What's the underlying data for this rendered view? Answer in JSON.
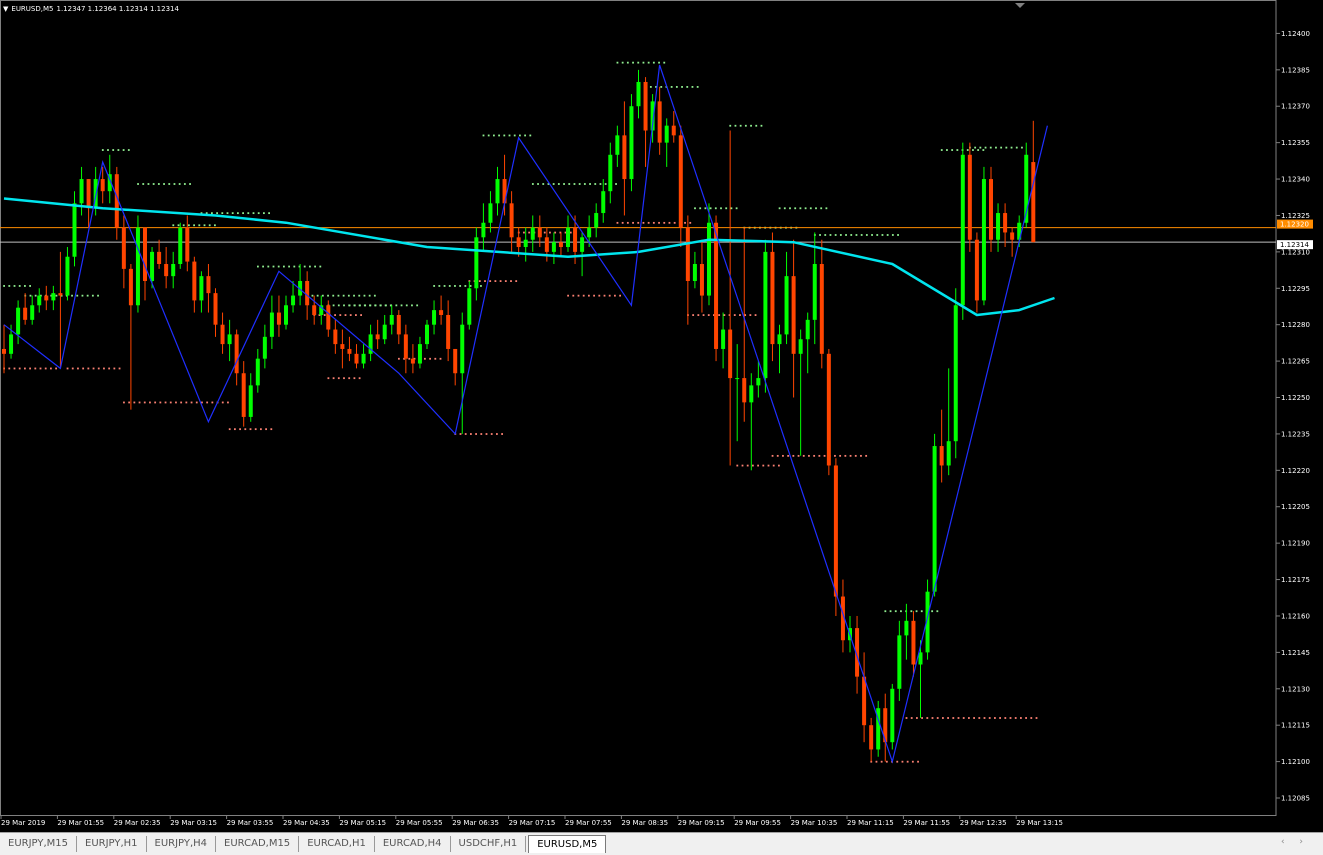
{
  "header": {
    "symbol": "EURUSD,M5",
    "ohlc": "1.12347 1.12364 1.12314 1.12314"
  },
  "tabs": [
    {
      "label": "EURJPY,M15",
      "active": false
    },
    {
      "label": "EURJPY,H1",
      "active": false
    },
    {
      "label": "EURJPY,H4",
      "active": false
    },
    {
      "label": "EURCAD,M15",
      "active": false
    },
    {
      "label": "EURCAD,H1",
      "active": false
    },
    {
      "label": "EURCAD,H4",
      "active": false
    },
    {
      "label": "USDCHF,H1",
      "active": false
    },
    {
      "label": "EURUSD,M5",
      "active": true
    }
  ],
  "scroll_arrows": "‹ ›",
  "chart_data": {
    "type": "candlestick",
    "symbol": "EURUSD",
    "timeframe": "M5",
    "colors": {
      "background": "#000000",
      "bull": "#00ff00",
      "bear": "#ff4500",
      "moving_average": "#00e5ee",
      "zigzag": "#1f2fff",
      "resistance_dots": "#90ee90",
      "support_dots": "#fa8072",
      "bid_line": "#c0c0c0",
      "ask_line": "#ff8c00",
      "axis_text": "#ffffff"
    },
    "y_axis": {
      "min": 1.12078,
      "max": 1.12408,
      "ticks": [
        "1.12400",
        "1.12385",
        "1.12370",
        "1.12355",
        "1.12340",
        "1.12325",
        "1.12310",
        "1.12295",
        "1.12280",
        "1.12265",
        "1.12250",
        "1.12235",
        "1.12220",
        "1.12205",
        "1.12190",
        "1.12175",
        "1.12160",
        "1.12145",
        "1.12130",
        "1.12115",
        "1.12100",
        "1.12085"
      ]
    },
    "x_axis": {
      "labels": [
        "29 Mar 2019",
        "29 Mar 01:55",
        "29 Mar 02:35",
        "29 Mar 03:15",
        "29 Mar 03:55",
        "29 Mar 04:35",
        "29 Mar 05:15",
        "29 Mar 05:55",
        "29 Mar 06:35",
        "29 Mar 07:15",
        "29 Mar 07:55",
        "29 Mar 08:35",
        "29 Mar 09:15",
        "29 Mar 09:55",
        "29 Mar 10:35",
        "29 Mar 11:15",
        "29 Mar 11:55",
        "29 Mar 12:35",
        "29 Mar 13:15"
      ],
      "candles_per_label": 8
    },
    "price_labels": [
      {
        "value": "1.12320",
        "kind": "ask"
      },
      {
        "value": "1.12314",
        "kind": "bid"
      }
    ],
    "ask_price": 1.1232,
    "bid_price": 1.12314,
    "ohlc": [
      [
        1.1227,
        1.1228,
        1.1226,
        1.12268
      ],
      [
        1.12268,
        1.1228,
        1.12266,
        1.12276
      ],
      [
        1.12276,
        1.1229,
        1.12272,
        1.12287
      ],
      [
        1.12287,
        1.12293,
        1.1228,
        1.12282
      ],
      [
        1.12282,
        1.12292,
        1.1228,
        1.12288
      ],
      [
        1.12288,
        1.12295,
        1.12285,
        1.12292
      ],
      [
        1.12292,
        1.12296,
        1.12286,
        1.1229
      ],
      [
        1.1229,
        1.12296,
        1.12286,
        1.12293
      ],
      [
        1.12293,
        1.1231,
        1.12262,
        1.12292
      ],
      [
        1.12292,
        1.12312,
        1.1229,
        1.12308
      ],
      [
        1.12308,
        1.12335,
        1.12304,
        1.1233
      ],
      [
        1.1233,
        1.12345,
        1.12325,
        1.1234
      ],
      [
        1.1234,
        1.1234,
        1.1232,
        1.12328
      ],
      [
        1.12328,
        1.12345,
        1.12325,
        1.1234
      ],
      [
        1.1234,
        1.12345,
        1.1233,
        1.12335
      ],
      [
        1.12335,
        1.1235,
        1.1233,
        1.12342
      ],
      [
        1.12342,
        1.12345,
        1.12315,
        1.1232
      ],
      [
        1.1232,
        1.12325,
        1.12295,
        1.12303
      ],
      [
        1.12303,
        1.12305,
        1.12245,
        1.12288
      ],
      [
        1.12288,
        1.12325,
        1.12285,
        1.1232
      ],
      [
        1.1232,
        1.1232,
        1.1229,
        1.12298
      ],
      [
        1.12298,
        1.12312,
        1.12295,
        1.1231
      ],
      [
        1.1231,
        1.12315,
        1.12303,
        1.12305
      ],
      [
        1.12305,
        1.12312,
        1.12295,
        1.123
      ],
      [
        1.123,
        1.1231,
        1.12295,
        1.12305
      ],
      [
        1.12305,
        1.12322,
        1.12303,
        1.1232
      ],
      [
        1.1232,
        1.12325,
        1.12302,
        1.12306
      ],
      [
        1.12306,
        1.12308,
        1.12285,
        1.1229
      ],
      [
        1.1229,
        1.12302,
        1.12285,
        1.123
      ],
      [
        1.123,
        1.12305,
        1.12285,
        1.12293
      ],
      [
        1.12293,
        1.12295,
        1.12275,
        1.1228
      ],
      [
        1.1228,
        1.12285,
        1.12268,
        1.12272
      ],
      [
        1.12272,
        1.12282,
        1.12265,
        1.12276
      ],
      [
        1.12276,
        1.12278,
        1.12255,
        1.1226
      ],
      [
        1.1226,
        1.12265,
        1.12238,
        1.12242
      ],
      [
        1.12242,
        1.1226,
        1.1224,
        1.12255
      ],
      [
        1.12255,
        1.1227,
        1.12252,
        1.12266
      ],
      [
        1.12266,
        1.1228,
        1.12262,
        1.12275
      ],
      [
        1.12275,
        1.12292,
        1.1227,
        1.12285
      ],
      [
        1.12285,
        1.12292,
        1.12275,
        1.1228
      ],
      [
        1.1228,
        1.12292,
        1.12278,
        1.12288
      ],
      [
        1.12288,
        1.12298,
        1.12285,
        1.12292
      ],
      [
        1.12292,
        1.12305,
        1.12288,
        1.12298
      ],
      [
        1.12298,
        1.12302,
        1.12282,
        1.12288
      ],
      [
        1.12288,
        1.12292,
        1.1228,
        1.12284
      ],
      [
        1.12284,
        1.12292,
        1.1228,
        1.12288
      ],
      [
        1.12288,
        1.1229,
        1.12275,
        1.12278
      ],
      [
        1.12278,
        1.12282,
        1.12268,
        1.12272
      ],
      [
        1.12272,
        1.12278,
        1.12262,
        1.1227
      ],
      [
        1.1227,
        1.12275,
        1.12265,
        1.12268
      ],
      [
        1.12268,
        1.12272,
        1.12262,
        1.12264
      ],
      [
        1.12264,
        1.12272,
        1.12262,
        1.12268
      ],
      [
        1.12268,
        1.1228,
        1.12265,
        1.12276
      ],
      [
        1.12276,
        1.12282,
        1.1227,
        1.12274
      ],
      [
        1.12274,
        1.12284,
        1.12272,
        1.1228
      ],
      [
        1.1228,
        1.12288,
        1.12276,
        1.12284
      ],
      [
        1.12284,
        1.12286,
        1.12272,
        1.12276
      ],
      [
        1.12276,
        1.1228,
        1.1226,
        1.12266
      ],
      [
        1.12266,
        1.12272,
        1.1226,
        1.12264
      ],
      [
        1.12264,
        1.12275,
        1.12262,
        1.12272
      ],
      [
        1.12272,
        1.12282,
        1.1227,
        1.1228
      ],
      [
        1.1228,
        1.1229,
        1.12276,
        1.12286
      ],
      [
        1.12286,
        1.12292,
        1.1228,
        1.12284
      ],
      [
        1.12284,
        1.1229,
        1.12265,
        1.1227
      ],
      [
        1.1227,
        1.1227,
        1.12255,
        1.1226
      ],
      [
        1.1226,
        1.12285,
        1.12235,
        1.1228
      ],
      [
        1.1228,
        1.12298,
        1.12278,
        1.12295
      ],
      [
        1.12295,
        1.1232,
        1.1229,
        1.12316
      ],
      [
        1.12316,
        1.1233,
        1.1231,
        1.12322
      ],
      [
        1.12322,
        1.12335,
        1.12318,
        1.1233
      ],
      [
        1.1233,
        1.12345,
        1.12325,
        1.1234
      ],
      [
        1.1234,
        1.1235,
        1.12325,
        1.1233
      ],
      [
        1.1233,
        1.12335,
        1.1231,
        1.12316
      ],
      [
        1.12316,
        1.1232,
        1.12308,
        1.12312
      ],
      [
        1.12312,
        1.1232,
        1.12306,
        1.12315
      ],
      [
        1.12315,
        1.12325,
        1.1231,
        1.1232
      ],
      [
        1.1232,
        1.12325,
        1.12312,
        1.12316
      ],
      [
        1.12316,
        1.1232,
        1.12306,
        1.1231
      ],
      [
        1.1231,
        1.12318,
        1.12305,
        1.12314
      ],
      [
        1.12314,
        1.12318,
        1.12308,
        1.12312
      ],
      [
        1.12312,
        1.12325,
        1.1231,
        1.1232
      ],
      [
        1.1232,
        1.12325,
        1.12305,
        1.1231
      ],
      [
        1.1231,
        1.12318,
        1.123,
        1.12316
      ],
      [
        1.12316,
        1.12325,
        1.12312,
        1.1232
      ],
      [
        1.1232,
        1.1233,
        1.12316,
        1.12326
      ],
      [
        1.12326,
        1.1234,
        1.12322,
        1.12335
      ],
      [
        1.12335,
        1.12355,
        1.1233,
        1.1235
      ],
      [
        1.1235,
        1.12362,
        1.12345,
        1.12358
      ],
      [
        1.12358,
        1.12372,
        1.12325,
        1.1234
      ],
      [
        1.1234,
        1.12375,
        1.12335,
        1.1237
      ],
      [
        1.1237,
        1.12385,
        1.12365,
        1.1238
      ],
      [
        1.1238,
        1.12382,
        1.12345,
        1.1236
      ],
      [
        1.1236,
        1.12375,
        1.12355,
        1.12372
      ],
      [
        1.12372,
        1.12378,
        1.1235,
        1.12355
      ],
      [
        1.12355,
        1.12365,
        1.12345,
        1.12362
      ],
      [
        1.12362,
        1.12368,
        1.12355,
        1.12358
      ],
      [
        1.12358,
        1.12362,
        1.12312,
        1.1232
      ],
      [
        1.1232,
        1.12325,
        1.1228,
        1.12298
      ],
      [
        1.12298,
        1.1231,
        1.12295,
        1.12305
      ],
      [
        1.12305,
        1.12315,
        1.12285,
        1.12292
      ],
      [
        1.12292,
        1.1233,
        1.12288,
        1.12322
      ],
      [
        1.12322,
        1.12325,
        1.12265,
        1.1227
      ],
      [
        1.1227,
        1.12285,
        1.12262,
        1.12278
      ],
      [
        1.12278,
        1.1236,
        1.12222,
        1.12258
      ],
      [
        1.12258,
        1.12272,
        1.12232,
        1.12258
      ],
      [
        1.12258,
        1.1232,
        1.1224,
        1.12248
      ],
      [
        1.12248,
        1.1226,
        1.1222,
        1.12255
      ],
      [
        1.12255,
        1.12265,
        1.1225,
        1.12258
      ],
      [
        1.12258,
        1.12315,
        1.12252,
        1.1231
      ],
      [
        1.1231,
        1.12318,
        1.12265,
        1.12272
      ],
      [
        1.12272,
        1.1228,
        1.1226,
        1.12276
      ],
      [
        1.12276,
        1.1231,
        1.12272,
        1.123
      ],
      [
        1.123,
        1.12315,
        1.1225,
        1.12268
      ],
      [
        1.12268,
        1.12278,
        1.12226,
        1.12274
      ],
      [
        1.12274,
        1.12285,
        1.1226,
        1.12282
      ],
      [
        1.12282,
        1.12318,
        1.12272,
        1.12305
      ],
      [
        1.12305,
        1.12315,
        1.12262,
        1.12268
      ],
      [
        1.12268,
        1.1227,
        1.12218,
        1.12222
      ],
      [
        1.12222,
        1.12225,
        1.1216,
        1.12168
      ],
      [
        1.12168,
        1.12175,
        1.12145,
        1.1215
      ],
      [
        1.1215,
        1.1216,
        1.12145,
        1.12155
      ],
      [
        1.12155,
        1.1216,
        1.12128,
        1.12135
      ],
      [
        1.12135,
        1.12145,
        1.12108,
        1.12115
      ],
      [
        1.12115,
        1.12118,
        1.121,
        1.12105
      ],
      [
        1.12105,
        1.12125,
        1.12102,
        1.12122
      ],
      [
        1.12122,
        1.12128,
        1.121,
        1.12108
      ],
      [
        1.12108,
        1.12132,
        1.12105,
        1.1213
      ],
      [
        1.1213,
        1.12158,
        1.12125,
        1.12152
      ],
      [
        1.12152,
        1.12165,
        1.12142,
        1.12158
      ],
      [
        1.12158,
        1.12162,
        1.12135,
        1.1214
      ],
      [
        1.1214,
        1.1215,
        1.12118,
        1.12145
      ],
      [
        1.12145,
        1.12175,
        1.12142,
        1.1217
      ],
      [
        1.1217,
        1.12235,
        1.12168,
        1.1223
      ],
      [
        1.1223,
        1.12245,
        1.12215,
        1.12222
      ],
      [
        1.12222,
        1.12262,
        1.12218,
        1.12232
      ],
      [
        1.12232,
        1.12295,
        1.12225,
        1.12288
      ],
      [
        1.12288,
        1.12355,
        1.12282,
        1.1235
      ],
      [
        1.1235,
        1.12355,
        1.1231,
        1.12315
      ],
      [
        1.12315,
        1.12318,
        1.12285,
        1.1229
      ],
      [
        1.1229,
        1.12345,
        1.12288,
        1.1234
      ],
      [
        1.1234,
        1.12345,
        1.1231,
        1.12315
      ],
      [
        1.12315,
        1.1233,
        1.1231,
        1.12326
      ],
      [
        1.12326,
        1.1233,
        1.12312,
        1.12318
      ],
      [
        1.12318,
        1.1232,
        1.12308,
        1.12315
      ],
      [
        1.12315,
        1.12325,
        1.12312,
        1.12322
      ],
      [
        1.12322,
        1.12355,
        1.1232,
        1.1235
      ],
      [
        1.12347,
        1.12364,
        1.12314,
        1.12314
      ]
    ],
    "moving_average": [
      [
        0,
        1.12332
      ],
      [
        14,
        1.12328
      ],
      [
        30,
        1.12325
      ],
      [
        40,
        1.12322
      ],
      [
        60,
        1.12312
      ],
      [
        80,
        1.12308
      ],
      [
        90,
        1.1231
      ],
      [
        100,
        1.12315
      ],
      [
        112,
        1.12314
      ],
      [
        126,
        1.12305
      ],
      [
        138,
        1.12284
      ],
      [
        144,
        1.12286
      ],
      [
        149,
        1.12291
      ]
    ],
    "zigzag": [
      [
        0,
        1.1228
      ],
      [
        8,
        1.12262
      ],
      [
        14,
        1.12347
      ],
      [
        29,
        1.1224
      ],
      [
        39,
        1.12302
      ],
      [
        56,
        1.1226
      ],
      [
        64,
        1.12235
      ],
      [
        73,
        1.12357
      ],
      [
        89,
        1.12288
      ],
      [
        93,
        1.12387
      ],
      [
        126,
        1.121
      ],
      [
        148,
        1.12362
      ]
    ],
    "resistance_levels": [
      [
        0,
        4,
        1.12296
      ],
      [
        3,
        14,
        1.12292
      ],
      [
        14,
        18,
        1.12352
      ],
      [
        19,
        27,
        1.12338
      ],
      [
        24,
        30,
        1.12321
      ],
      [
        28,
        38,
        1.12326
      ],
      [
        36,
        45,
        1.12304
      ],
      [
        43,
        53,
        1.12292
      ],
      [
        46,
        55,
        1.12288
      ],
      [
        49,
        59,
        1.12288
      ],
      [
        61,
        68,
        1.12296
      ],
      [
        68,
        75,
        1.12358
      ],
      [
        75,
        87,
        1.12338
      ],
      [
        87,
        94,
        1.12388
      ],
      [
        91,
        99,
        1.12378
      ],
      [
        98,
        104,
        1.12328
      ],
      [
        103,
        108,
        1.12362
      ],
      [
        105,
        113,
        1.1232
      ],
      [
        110,
        117,
        1.12328
      ],
      [
        115,
        127,
        1.12317
      ],
      [
        125,
        133,
        1.12162
      ],
      [
        133,
        139,
        1.12352
      ],
      [
        137,
        145,
        1.12353
      ]
    ],
    "support_levels": [
      [
        0,
        8,
        1.12262
      ],
      [
        9,
        17,
        1.12262
      ],
      [
        17,
        32,
        1.12248
      ],
      [
        32,
        38,
        1.12237
      ],
      [
        44,
        51,
        1.12284
      ],
      [
        46,
        51,
        1.12258
      ],
      [
        56,
        62,
        1.12266
      ],
      [
        64,
        71,
        1.12235
      ],
      [
        66,
        73,
        1.12298
      ],
      [
        73,
        81,
        1.12318
      ],
      [
        80,
        88,
        1.12292
      ],
      [
        87,
        98,
        1.12322
      ],
      [
        97,
        107,
        1.12284
      ],
      [
        104,
        110,
        1.12222
      ],
      [
        109,
        123,
        1.12226
      ],
      [
        123,
        130,
        1.121
      ],
      [
        128,
        147,
        1.12118
      ]
    ]
  }
}
